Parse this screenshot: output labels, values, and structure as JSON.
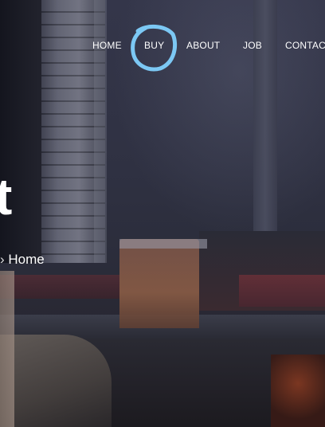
{
  "nav": {
    "items": [
      {
        "label": "HOME"
      },
      {
        "label": "BUY"
      },
      {
        "label": "ABOUT"
      },
      {
        "label": "JOB"
      },
      {
        "label": "CONTACT"
      }
    ],
    "highlight_color": "#7cc8f4"
  },
  "hero": {
    "title": "t",
    "breadcrumb": {
      "separator": "›",
      "home": "Home"
    }
  }
}
